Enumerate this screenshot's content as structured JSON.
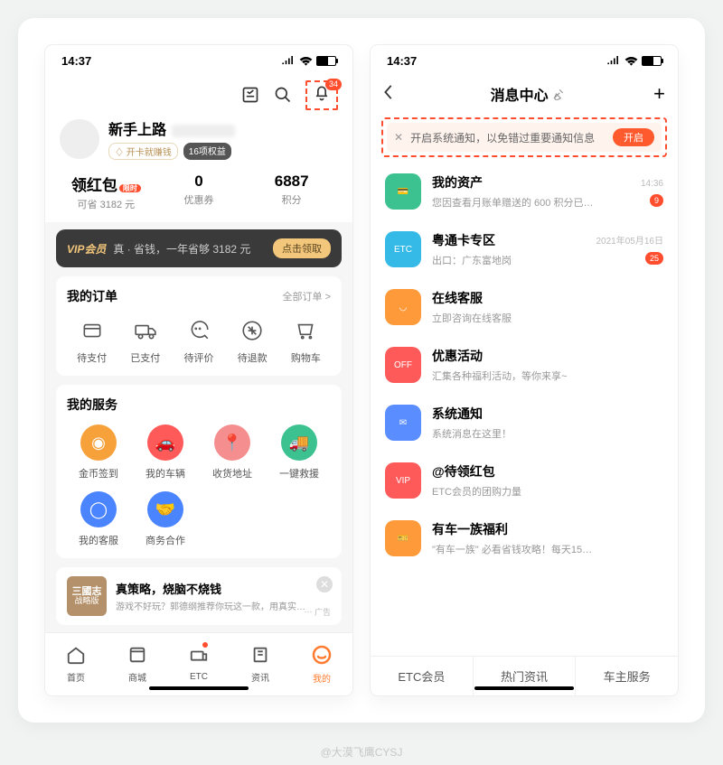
{
  "watermark": "@大漠飞鹰CYSJ",
  "status": {
    "time": "14:37"
  },
  "left": {
    "bell_badge": "34",
    "profile": {
      "name": "新手上路",
      "tag1": "开卡就赚钱",
      "tag2": "16项权益"
    },
    "stats": [
      {
        "value": "领红包",
        "label": "可省 3182 元",
        "hot": "限时"
      },
      {
        "value": "0",
        "label": "优惠券"
      },
      {
        "value": "6887",
        "label": "积分"
      }
    ],
    "vip": {
      "logo": "VIP会员",
      "text": "真 · 省钱，一年省够 3182 元",
      "btn": "点击领取"
    },
    "orders": {
      "title": "我的订单",
      "more": "全部订单 >",
      "items": [
        "待支付",
        "已支付",
        "待评价",
        "待退款",
        "购物车"
      ]
    },
    "services": {
      "title": "我的服务",
      "items": [
        "金币签到",
        "我的车辆",
        "收货地址",
        "一键救援",
        "我的客服",
        "商务合作"
      ],
      "colors": [
        "#f7a13b",
        "#ff5a5a",
        "#f58e8e",
        "#3cc190",
        "#4a84ff",
        "#4a84ff"
      ]
    },
    "ad": {
      "thumb1": "三國志",
      "thumb2": "战略版",
      "title": "真策略，烧脑不烧钱",
      "sub": "游戏不好玩？郭德纲推荐你玩这一款，用真实…",
      "tag": "广告"
    },
    "tabs": [
      "首页",
      "商城",
      "ETC",
      "资讯",
      "我的"
    ]
  },
  "right": {
    "title": "消息中心",
    "banner": {
      "msg": "开启系统通知，以免错过重要通知信息",
      "btn": "开启"
    },
    "rows": [
      {
        "name": "我的资产",
        "desc": "您因查看月账单赠送的 600 积分已…",
        "time": "14:36",
        "count": "9",
        "color": "#3cc190"
      },
      {
        "name": "粤通卡专区",
        "desc": "出口：广东富地岗",
        "time": "2021年05月16日",
        "count": "25",
        "color": "#35b9e6"
      },
      {
        "name": "在线客服",
        "desc": "立即咨询在线客服",
        "color": "#ff9a3b"
      },
      {
        "name": "优惠活动",
        "desc": "汇集各种福利活动，等你来享~",
        "color": "#ff5a5a"
      },
      {
        "name": "系统通知",
        "desc": "系统消息在这里！",
        "color": "#5a8dff"
      },
      {
        "name": "@待领红包",
        "desc": "ETC会员的团购力量",
        "color": "#ff5a5a",
        "tag": "VIP"
      },
      {
        "name": "有车一族福利",
        "desc": "\"有车一族\" 必看省钱攻略！每天15…",
        "color": "#ff9a3b"
      }
    ],
    "bottom": [
      "ETC会员",
      "热门资讯",
      "车主服务"
    ]
  }
}
